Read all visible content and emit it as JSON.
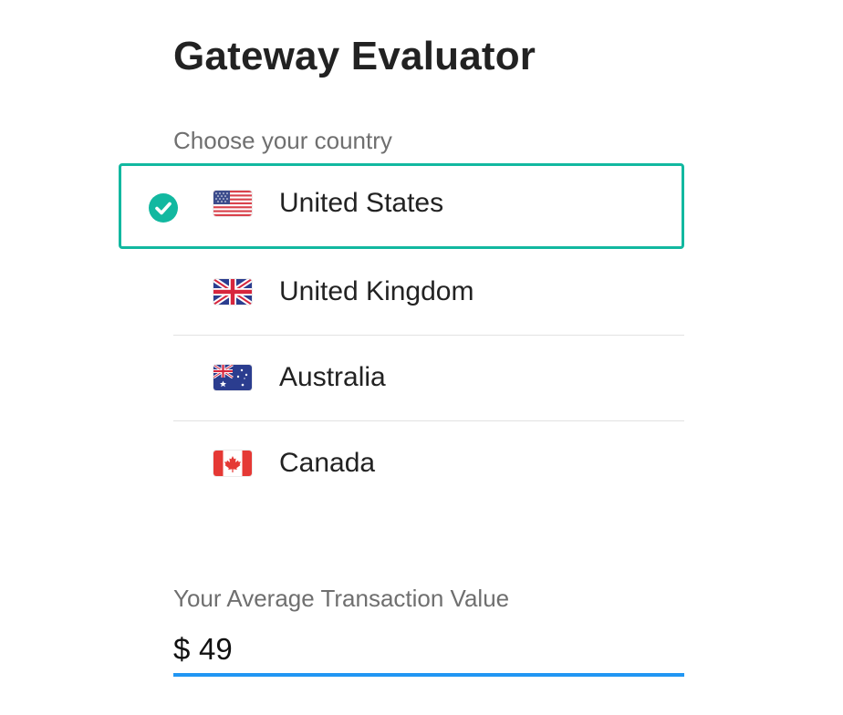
{
  "page": {
    "title": "Gateway Evaluator"
  },
  "country_section": {
    "label": "Choose your country",
    "selected": "United States",
    "options": [
      {
        "name": "United States",
        "flag_icon": "us-flag-icon",
        "selected": true
      },
      {
        "name": "United Kingdom",
        "flag_icon": "uk-flag-icon",
        "selected": false
      },
      {
        "name": "Australia",
        "flag_icon": "australia-flag-icon",
        "selected": false
      },
      {
        "name": "Canada",
        "flag_icon": "canada-flag-icon",
        "selected": false
      }
    ],
    "selected_icon": "check-circle-icon"
  },
  "transaction_section": {
    "label": "Your Average Transaction Value",
    "currency_symbol": "$",
    "value": "49"
  },
  "colors": {
    "accent_selected": "#12b8a0",
    "input_underline": "#2196f3",
    "label_gray": "#6f6f6f",
    "text_dark": "#222222"
  }
}
